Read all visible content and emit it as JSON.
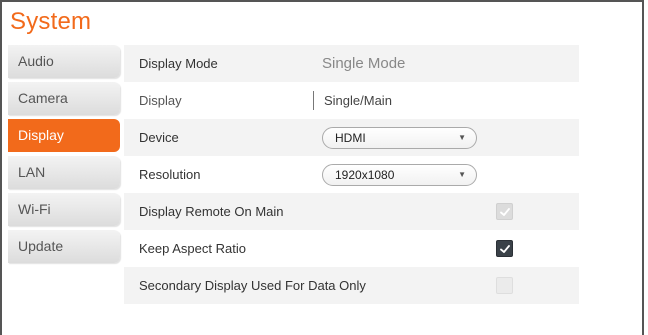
{
  "header": {
    "title": "System"
  },
  "sidebar": {
    "items": [
      {
        "label": "Audio"
      },
      {
        "label": "Camera"
      },
      {
        "label": "Display"
      },
      {
        "label": "LAN"
      },
      {
        "label": "Wi-Fi"
      },
      {
        "label": "Update"
      }
    ],
    "active_index": 2
  },
  "settings": {
    "display_mode": {
      "label": "Display Mode",
      "value": "Single Mode"
    },
    "display": {
      "label": "Display",
      "value": "Single/Main"
    },
    "device": {
      "label": "Device",
      "selected": "HDMI"
    },
    "resolution": {
      "label": "Resolution",
      "selected": "1920x1080"
    },
    "display_remote_on_main": {
      "label": "Display Remote On Main",
      "checked": true,
      "disabled": true
    },
    "keep_aspect_ratio": {
      "label": "Keep Aspect Ratio",
      "checked": true,
      "disabled": false
    },
    "secondary_display_data_only": {
      "label": "Secondary Display Used For Data Only",
      "checked": false,
      "disabled": true
    }
  },
  "colors": {
    "accent": "#f26a1b",
    "checkbox_checked": "#3a4148",
    "row_shade": "#f3f3f3"
  },
  "icons": {
    "caret": "chevron-down-icon",
    "check": "checkmark-icon"
  }
}
